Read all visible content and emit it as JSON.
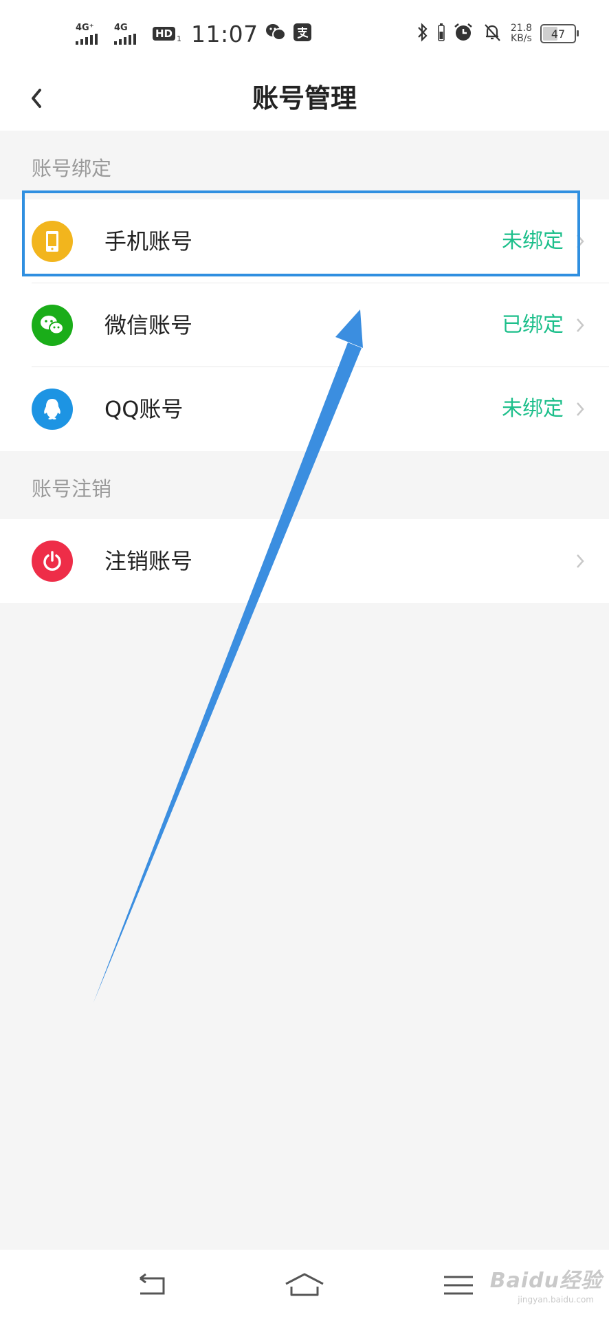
{
  "status_bar": {
    "net1_label": "4G⁺",
    "net2_label": "4G",
    "hd_label": "HD",
    "hd_sub": "1",
    "time": "11:07",
    "speed_value": "21.8",
    "speed_unit": "KB/s",
    "battery": "47",
    "battery_level": 0.47
  },
  "header": {
    "title": "账号管理"
  },
  "sections": {
    "binding": {
      "label": "账号绑定",
      "items": [
        {
          "label": "手机账号",
          "value": "未绑定",
          "icon": "phone-icon",
          "color": "#f2b51d"
        },
        {
          "label": "微信账号",
          "value": "已绑定",
          "icon": "wechat-icon",
          "color": "#1aad19"
        },
        {
          "label": "QQ账号",
          "value": "未绑定",
          "icon": "qq-penguin-icon",
          "color": "#1d94e3"
        }
      ]
    },
    "cancel": {
      "label": "账号注销",
      "items": [
        {
          "label": "注销账号",
          "value": "",
          "icon": "power-icon",
          "color": "#ee2d48"
        }
      ]
    }
  },
  "status_value_color": "#1dbf8b",
  "annotation_color": "#2f8fe0",
  "watermark": {
    "text": "Baidu经验",
    "url": "jingyan.baidu.com"
  }
}
